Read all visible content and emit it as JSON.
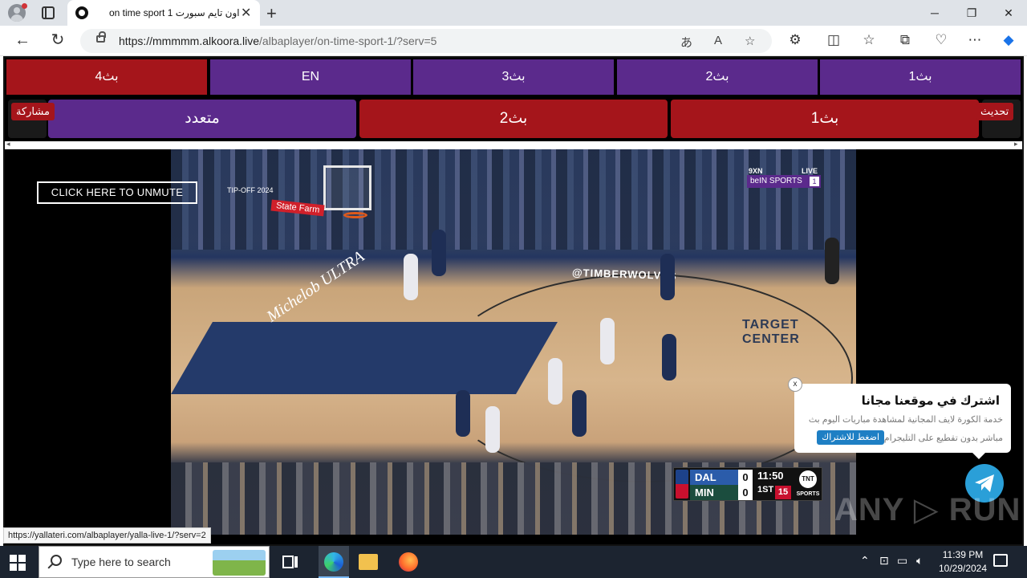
{
  "browser": {
    "tab_title": "on time sport 1 اون تايم سبورت",
    "url_host": "https://mmmmm.alkoora.live",
    "url_path": "/albaplayer/on-time-sport-1/?serv=5",
    "status_url": "https://yallateri.com/albaplayer/yalla-live-1/?serv=2"
  },
  "servers": {
    "row1": [
      "بث4",
      "EN",
      "بث3",
      "بث2",
      "بث1"
    ],
    "row2": [
      "متعدد",
      "بث2",
      "بث1"
    ],
    "share_label": "مشاركة",
    "refresh_label": "تحديث"
  },
  "video": {
    "unmute_label": "CLICK HERE TO UNMUTE",
    "broadcaster": "beIN SPORTS",
    "channel": "1",
    "live_tag": "LIVE",
    "corner_tag": "9XN",
    "sponsor_text": "State Farm",
    "tipoff_text": "TIP-OFF 2024",
    "court_text_1": "@TIMBERWOLVES",
    "court_text_2": "TARGET CENTER",
    "court_text_3": "Michelob ULTRA",
    "scoreboard": {
      "teams": [
        {
          "abbr": "DAL",
          "score": "0",
          "color": "#2b5caa"
        },
        {
          "abbr": "MIN",
          "score": "0",
          "color": "#1b4d3e"
        }
      ],
      "clock": "11:50",
      "period": "1ST",
      "shot_clock": "15",
      "network": "TNT",
      "network_sub": "SPORTS"
    }
  },
  "popup": {
    "close": "x",
    "title": "اشترك في موقعنا مجانا",
    "line1": "خدمة الكورة لايف المجانية لمشاهدة مباريات اليوم بث",
    "line2": "مباشر بدون تقطيع على التليجرام",
    "button": "اضغط للاشتراك"
  },
  "watermark": "ANY ▷ RUN",
  "taskbar": {
    "search_placeholder": "Type here to search",
    "time": "11:39 PM",
    "date": "10/29/2024"
  },
  "colors": {
    "purple": "#5b2a8c",
    "red": "#a5151b",
    "telegram": "#2a9fd8"
  }
}
